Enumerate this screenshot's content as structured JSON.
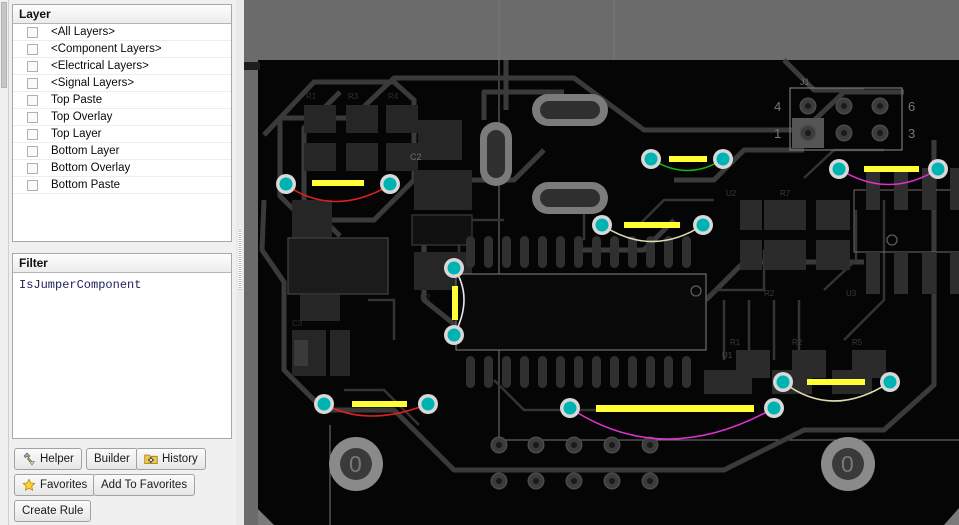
{
  "panel": {
    "layer": {
      "header": "Layer",
      "items": [
        {
          "label": "<All Layers>",
          "checked": false
        },
        {
          "label": "<Component Layers>",
          "checked": false
        },
        {
          "label": "<Electrical Layers>",
          "checked": false
        },
        {
          "label": "<Signal Layers>",
          "checked": false
        },
        {
          "label": "Top Paste",
          "checked": false
        },
        {
          "label": "Top Overlay",
          "checked": false
        },
        {
          "label": "Top Layer",
          "checked": false
        },
        {
          "label": "Bottom Layer",
          "checked": false
        },
        {
          "label": "Bottom Overlay",
          "checked": false
        },
        {
          "label": "Bottom Paste",
          "checked": false
        }
      ]
    },
    "filter": {
      "header": "Filter",
      "value": "IsJumperComponent"
    },
    "buttons": {
      "helper": "Helper",
      "builder": "Builder",
      "history": "History",
      "favorites": "Favorites",
      "add_to_favorites": "Add To Favorites",
      "create_rule": "Create Rule"
    }
  },
  "pcb": {
    "background_color": "#6b6b6b",
    "board_color": "#050505",
    "pad_color": "#00b3b3",
    "pad_ring_color": "#d8d8d8",
    "jumper_bar_color": "#ffff33",
    "connector_pin_labels": [
      "4",
      "1",
      "6",
      "3"
    ],
    "mounting_hole_labels": [
      "0",
      "0"
    ],
    "connection_colors": {
      "red": "#e02020",
      "green": "#18b818",
      "magenta": "#e030d0",
      "pale": "#d8dcae",
      "white": "#e8e8e8"
    },
    "designators": [
      "C2",
      "R2",
      "R3",
      "J1",
      "U1"
    ]
  }
}
